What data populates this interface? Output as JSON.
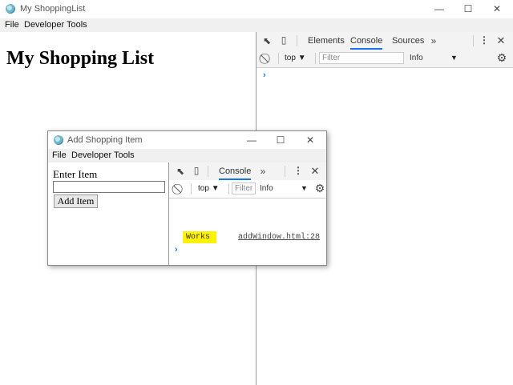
{
  "main": {
    "title": "My ShoppingList",
    "menu": [
      "File",
      "Developer Tools"
    ],
    "heading": "My Shopping List",
    "devtools": {
      "tabs": [
        "Elements",
        "Console",
        "Sources"
      ],
      "active_tab": "Console",
      "context": "top",
      "filter_placeholder": "Filter",
      "level": "Info"
    }
  },
  "child": {
    "title": "Add Shopping Item",
    "menu": [
      "File",
      "Developer Tools"
    ],
    "form": {
      "label": "Enter Item",
      "input_value": "",
      "button": "Add Item"
    },
    "devtools": {
      "tabs": [
        "Console"
      ],
      "context": "top",
      "filter_placeholder": "Filter",
      "level": "Info",
      "log": {
        "message": "Works",
        "source": "addWindow.html:28",
        "highlight": "#fff200"
      }
    }
  },
  "colors": {
    "accent": "#1a73e8",
    "highlight": "#fff200"
  }
}
